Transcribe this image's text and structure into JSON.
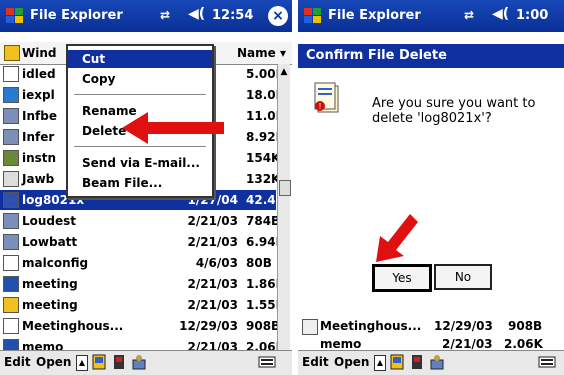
{
  "left": {
    "app_title": "File Explorer",
    "clock": "12:54",
    "close_symbol": "×",
    "folder_label": "Wind",
    "sort_label": "Name ▾",
    "context_menu": [
      {
        "label": "Cut",
        "highlight": true
      },
      {
        "label": "Copy"
      },
      {
        "label": "Rename"
      },
      {
        "label": "Delete"
      },
      {
        "label": "Send via E-mail..."
      },
      {
        "label": "Beam File..."
      }
    ],
    "rows": [
      {
        "name": "idled",
        "date": "",
        "size": "5.00K",
        "icon": "file-icon"
      },
      {
        "name": "iexpl",
        "date": "",
        "size": "18.0K",
        "icon": "ie-icon"
      },
      {
        "name": "Infbe",
        "date": "",
        "size": "11.0K",
        "icon": "sound-icon"
      },
      {
        "name": "Infer",
        "date": "",
        "size": "8.92K",
        "icon": "sound-icon"
      },
      {
        "name": "instn",
        "date": "",
        "size": "154K",
        "icon": "install-icon"
      },
      {
        "name": "Jawb",
        "date": "",
        "size": "132K",
        "icon": "jawbreaker-icon"
      },
      {
        "name": "log8021x",
        "date": "1/27/04",
        "size": "42.4K",
        "icon": "log-icon",
        "selected": true
      },
      {
        "name": "Loudest",
        "date": "2/21/03",
        "size": "784B",
        "icon": "sound-icon"
      },
      {
        "name": "Lowbatt",
        "date": "2/21/03",
        "size": "6.94K",
        "icon": "sound-icon"
      },
      {
        "name": "malconfig",
        "date": "4/6/03",
        "size": "80B",
        "icon": "doc-icon"
      },
      {
        "name": "meeting",
        "date": "2/21/03",
        "size": "1.86K",
        "icon": "word-icon"
      },
      {
        "name": "meeting",
        "date": "2/21/03",
        "size": "1.55K",
        "icon": "folder-doc-icon"
      },
      {
        "name": "Meetinghous...",
        "date": "12/29/03",
        "size": "908B",
        "icon": "doc-icon"
      },
      {
        "name": "memo",
        "date": "2/21/03",
        "size": "2.06K",
        "icon": "word-icon"
      }
    ],
    "bottom": {
      "edit": "Edit",
      "open": "Open"
    }
  },
  "right": {
    "app_title": "File Explorer",
    "clock": "1:00",
    "dialog_title": "Confirm File Delete",
    "message": "Are you sure you want to delete 'log8021x'?",
    "yes": "Yes",
    "no": "No",
    "under_rows": [
      {
        "name": "Meetinghous...",
        "date": "12/29/03",
        "size": "908B"
      },
      {
        "name": "memo",
        "date": "2/21/03",
        "size": "2.06K"
      }
    ],
    "bottom": {
      "edit": "Edit",
      "open": "Open"
    }
  },
  "colors": {
    "titlebar": "#0a2f96",
    "selection": "#1030a0",
    "arrow": "#e01010"
  }
}
